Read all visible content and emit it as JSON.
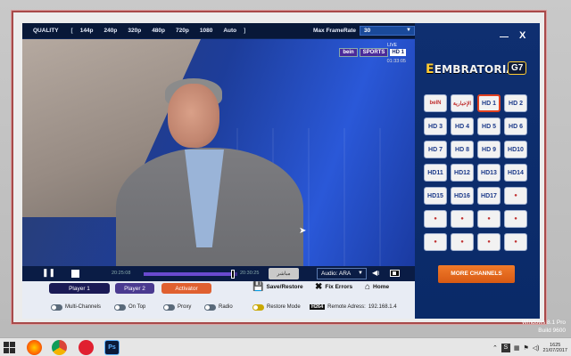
{
  "quality_bar": {
    "label": "QUALITY",
    "options": [
      "144p",
      "240p",
      "320p",
      "480p",
      "720p",
      "1080",
      "Auto"
    ],
    "maxframerate_label": "Max FrameRate",
    "framerate_value": "30"
  },
  "video": {
    "live_label": "LIVE",
    "channel_brand": "bein",
    "channel_name": "SPORTS",
    "channel_hd": "HD 1",
    "clock": "01:33:05"
  },
  "player": {
    "time_left": "20:25:08",
    "time_right": "20:30:25",
    "seek_fraction": 0.95,
    "live_button": "مباشر",
    "audio": "Audio: ARA"
  },
  "bottom": {
    "tab_player1": "Player 1",
    "tab_player2": "Player 2",
    "tab_activator": "Activator",
    "save_restore": "Save/Restore",
    "fix_errors": "Fix Errors",
    "home": "Home",
    "toggle_multichannels": "Multi-Channels",
    "toggle_ontop": "On Top",
    "toggle_proxy": "Proxy",
    "toggle_radio": "Radio",
    "toggle_restore_mode": "Restore Mode",
    "hd_badge": "H264",
    "remote_label": "Remote Adress:",
    "remote_value": "192.168.1.4"
  },
  "sidebar": {
    "brand": "EMBRATORIA",
    "brand_e": "E",
    "brand_model": "G7",
    "more_channels": "MORE CHANNELS",
    "channels": [
      {
        "label": "beIN",
        "logo": true,
        "active": false
      },
      {
        "label": "الإخبارية",
        "logo": true,
        "active": false
      },
      {
        "label": "HD 1",
        "logo": false,
        "active": true
      },
      {
        "label": "HD 2",
        "logo": false,
        "active": false
      },
      {
        "label": "HD 3",
        "logo": false,
        "active": false
      },
      {
        "label": "HD 4",
        "logo": false,
        "active": false
      },
      {
        "label": "HD 5",
        "logo": false,
        "active": false
      },
      {
        "label": "HD 6",
        "logo": false,
        "active": false
      },
      {
        "label": "HD 7",
        "logo": false,
        "active": false
      },
      {
        "label": "HD 8",
        "logo": false,
        "active": false
      },
      {
        "label": "HD 9",
        "logo": false,
        "active": false
      },
      {
        "label": "HD10",
        "logo": false,
        "active": false
      },
      {
        "label": "HD11",
        "logo": false,
        "active": false
      },
      {
        "label": "HD12",
        "logo": false,
        "active": false
      },
      {
        "label": "HD13",
        "logo": false,
        "active": false
      },
      {
        "label": "HD14",
        "logo": false,
        "active": false
      },
      {
        "label": "HD15",
        "logo": false,
        "active": false
      },
      {
        "label": "HD16",
        "logo": false,
        "active": false
      },
      {
        "label": "HD17",
        "logo": false,
        "active": false
      },
      {
        "label": "●",
        "logo": true,
        "active": false
      },
      {
        "label": "●",
        "logo": true,
        "active": false
      },
      {
        "label": "●",
        "logo": true,
        "active": false
      },
      {
        "label": "●",
        "logo": true,
        "active": false
      },
      {
        "label": "●",
        "logo": true,
        "active": false
      },
      {
        "label": "●",
        "logo": true,
        "active": false
      },
      {
        "label": "●",
        "logo": true,
        "active": false
      },
      {
        "label": "●",
        "logo": true,
        "active": false
      },
      {
        "label": "●",
        "logo": true,
        "active": false
      }
    ]
  },
  "taskbar": {
    "tray_s": "S",
    "time": "1625",
    "date": "21/07/2017",
    "ps_label": "Ps"
  },
  "watermark": {
    "line1": "Windows 8.1 Pro",
    "line2": "Build 9600"
  }
}
